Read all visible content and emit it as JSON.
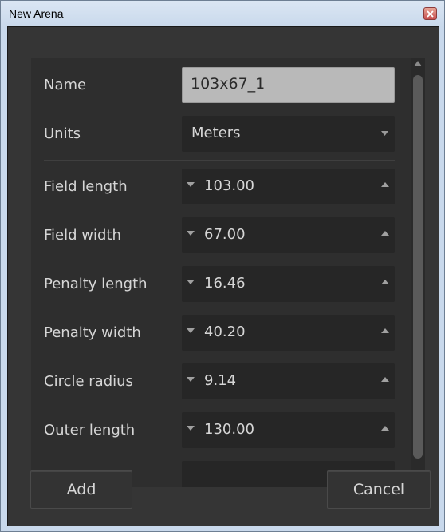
{
  "window": {
    "title": "New Arena"
  },
  "form": {
    "name_label": "Name",
    "name_value": "103x67_1",
    "units_label": "Units",
    "units_value": "Meters",
    "fields": [
      {
        "label": "Field length",
        "value": "103.00"
      },
      {
        "label": "Field width",
        "value": "67.00"
      },
      {
        "label": "Penalty length",
        "value": "16.46"
      },
      {
        "label": "Penalty width",
        "value": "40.20"
      },
      {
        "label": "Circle radius",
        "value": "9.14"
      },
      {
        "label": "Outer length",
        "value": "130.00"
      }
    ]
  },
  "buttons": {
    "add": "Add",
    "cancel": "Cancel"
  },
  "icons": {
    "close": "close-icon",
    "spin_down": "triangle-down-icon",
    "spin_up": "triangle-up-icon",
    "combo_arrow": "chevron-down-icon"
  },
  "colors": {
    "panel": "#353535",
    "field": "#262626",
    "name_field": "#b9b9b9",
    "text": "#d6d6d6",
    "titlebar": "#c9d9ec"
  }
}
